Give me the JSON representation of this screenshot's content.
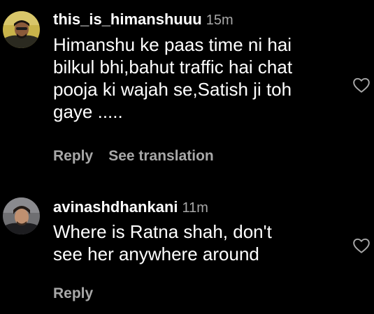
{
  "comments": [
    {
      "username": "this_is_himanshuuu",
      "time": "15m",
      "lines": [
        "Himanshu ke paas time ni hai",
        "bilkul bhi,bahut traffic hai chat",
        "pooja ki wajah se,Satish ji toh",
        "gaye ....."
      ],
      "reply_label": "Reply",
      "translation_label": "See translation",
      "like_icon": "heart-outline-icon"
    },
    {
      "username": "avinashdhankani",
      "time": "11m",
      "lines": [
        "Where is Ratna shah, don't",
        "see her anywhere around"
      ],
      "reply_label": "Reply",
      "like_icon": "heart-outline-icon"
    }
  ],
  "colors": {
    "background": "#000000",
    "text": "#ffffff",
    "secondary": "#a8a8a8"
  }
}
